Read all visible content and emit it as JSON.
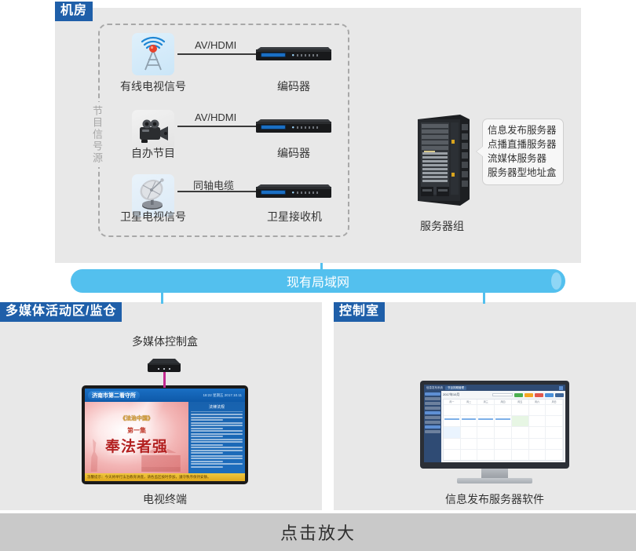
{
  "sections": {
    "machine_room": {
      "badge": "机房"
    },
    "multimedia": {
      "badge": "多媒体活动区/监仓"
    },
    "control_room": {
      "badge": "控制室"
    }
  },
  "signal_source": {
    "vertical_label": "节目信号源"
  },
  "sources": [
    {
      "icon": "broadcast-tower-icon",
      "label": "有线电视信号",
      "link_label": "AV/HDMI",
      "target_icon": "rack-encoder-icon",
      "target_label": "编码器"
    },
    {
      "icon": "camcorder-icon",
      "label": "自办节目",
      "link_label": "AV/HDMI",
      "target_icon": "rack-encoder-icon",
      "target_label": "编码器"
    },
    {
      "icon": "satellite-dish-icon",
      "label": "卫星电视信号",
      "link_label": "同轴电缆",
      "target_icon": "rack-receiver-icon",
      "target_label": "卫星接收机"
    }
  ],
  "server_group": {
    "label": "服务器组",
    "callout": [
      "信息发布服务器",
      "点播直播服务器",
      "流媒体服务器",
      "服务器型地址盒"
    ]
  },
  "lan": {
    "label": "现有局域网"
  },
  "multimedia_area": {
    "control_box_label": "多媒体控制盒",
    "terminal_label": "电视终端",
    "tv": {
      "header_title": "济南市第二看守所",
      "header_time": "18:22 星期五 2017.10.11",
      "title_small": "《法治中国》",
      "title_sub": "第一集",
      "title_main": "奉法者强",
      "side_header": "法律法规",
      "ticker": "温馨提示：今天将举行法治教育讲座，请各监区按时参加，遵守秩序保持安静。"
    }
  },
  "control_area": {
    "software_label": "信息发布服务器软件",
    "software": {
      "app_title": "信息发布系统",
      "tab": "节目排期管理",
      "calendar_title": "2017年10月",
      "weekdays": [
        "周一",
        "周二",
        "周三",
        "周四",
        "周五",
        "周六",
        "周日"
      ],
      "buttons": [
        {
          "label": "新建",
          "color": "#4caf50"
        },
        {
          "label": "编辑",
          "color": "#f5a623"
        },
        {
          "label": "删除",
          "color": "#e2574c"
        },
        {
          "label": "查询",
          "color": "#4a90d9"
        },
        {
          "label": "导出",
          "color": "#3f6699"
        }
      ]
    }
  },
  "footer": {
    "label": "点击放大"
  },
  "colors": {
    "badge_blue": "#1f5fa9",
    "lan_blue": "#53c0ee",
    "panel_gray": "#e8e8e8",
    "footer_gray": "#c9c9c9",
    "cable_magenta": "#c2298f"
  }
}
